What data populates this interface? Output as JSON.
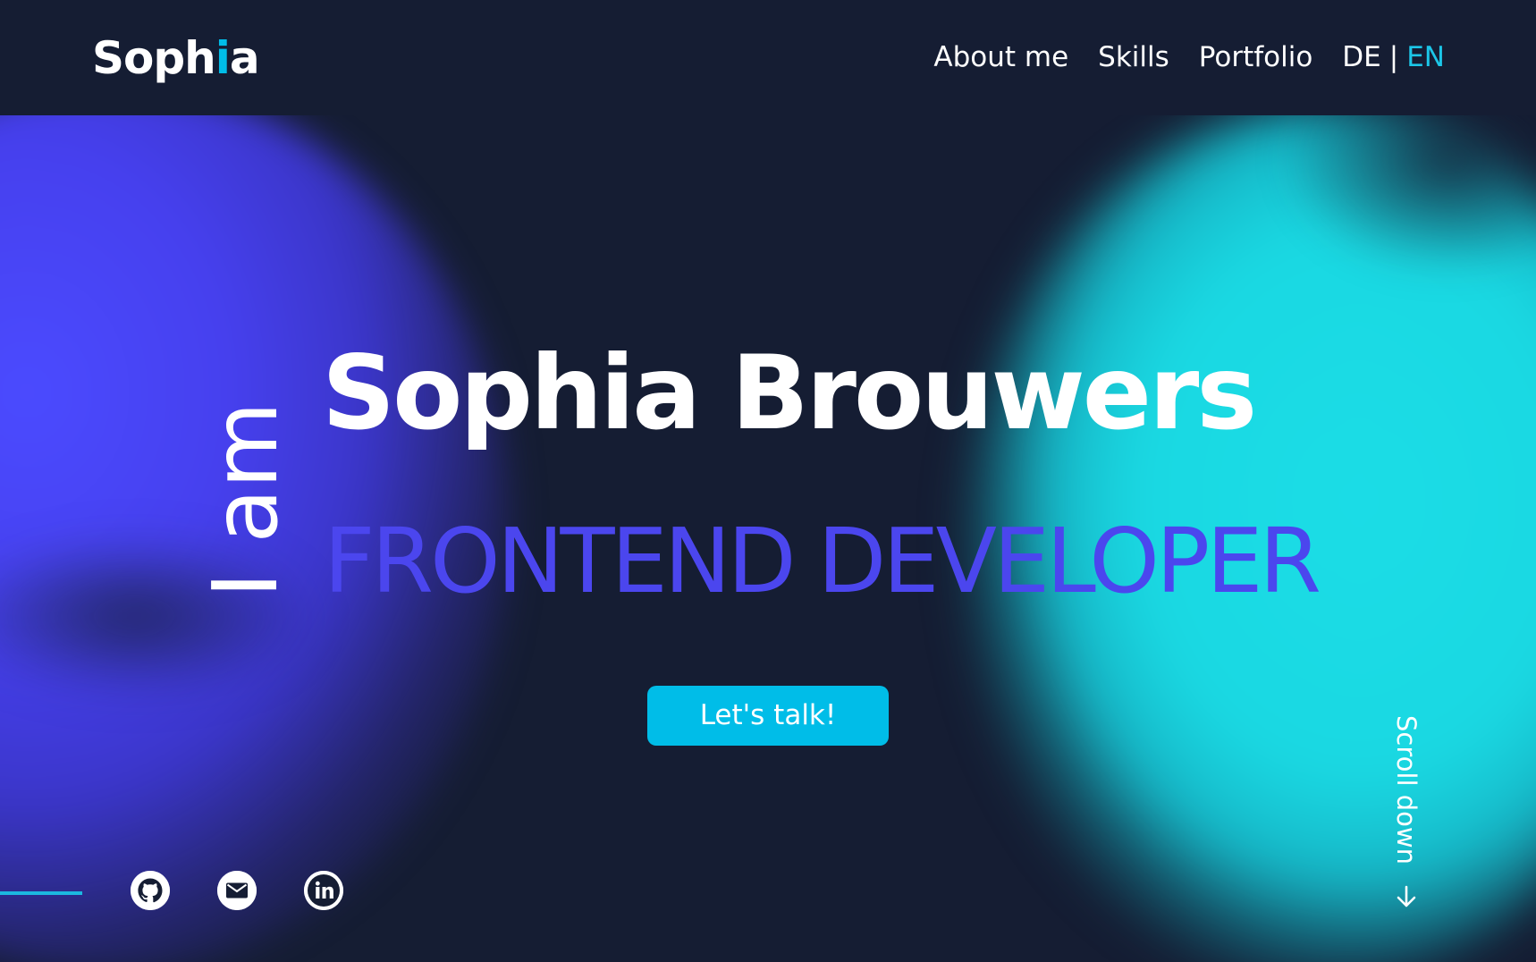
{
  "header": {
    "logo": {
      "text_main": "Soph",
      "text_accent": "i",
      "text_end": "a"
    },
    "nav": {
      "about": "About me",
      "skills": "Skills",
      "portfolio": "Portfolio",
      "lang_de": "DE",
      "lang_separator": "|",
      "lang_en": "EN",
      "active_language": "EN"
    }
  },
  "hero": {
    "intro": "I am",
    "name": "Sophia Brouwers",
    "role": "FRONTEND DEVELOPER",
    "cta_label": "Let's talk!",
    "scroll_label": "Scroll down"
  },
  "social": {
    "icons": [
      "github-icon",
      "email-icon",
      "linkedin-icon"
    ]
  },
  "colors": {
    "background": "#151d33",
    "accent_cyan": "#00bde8",
    "accent_purple": "#4b46ee",
    "text": "#ffffff"
  }
}
